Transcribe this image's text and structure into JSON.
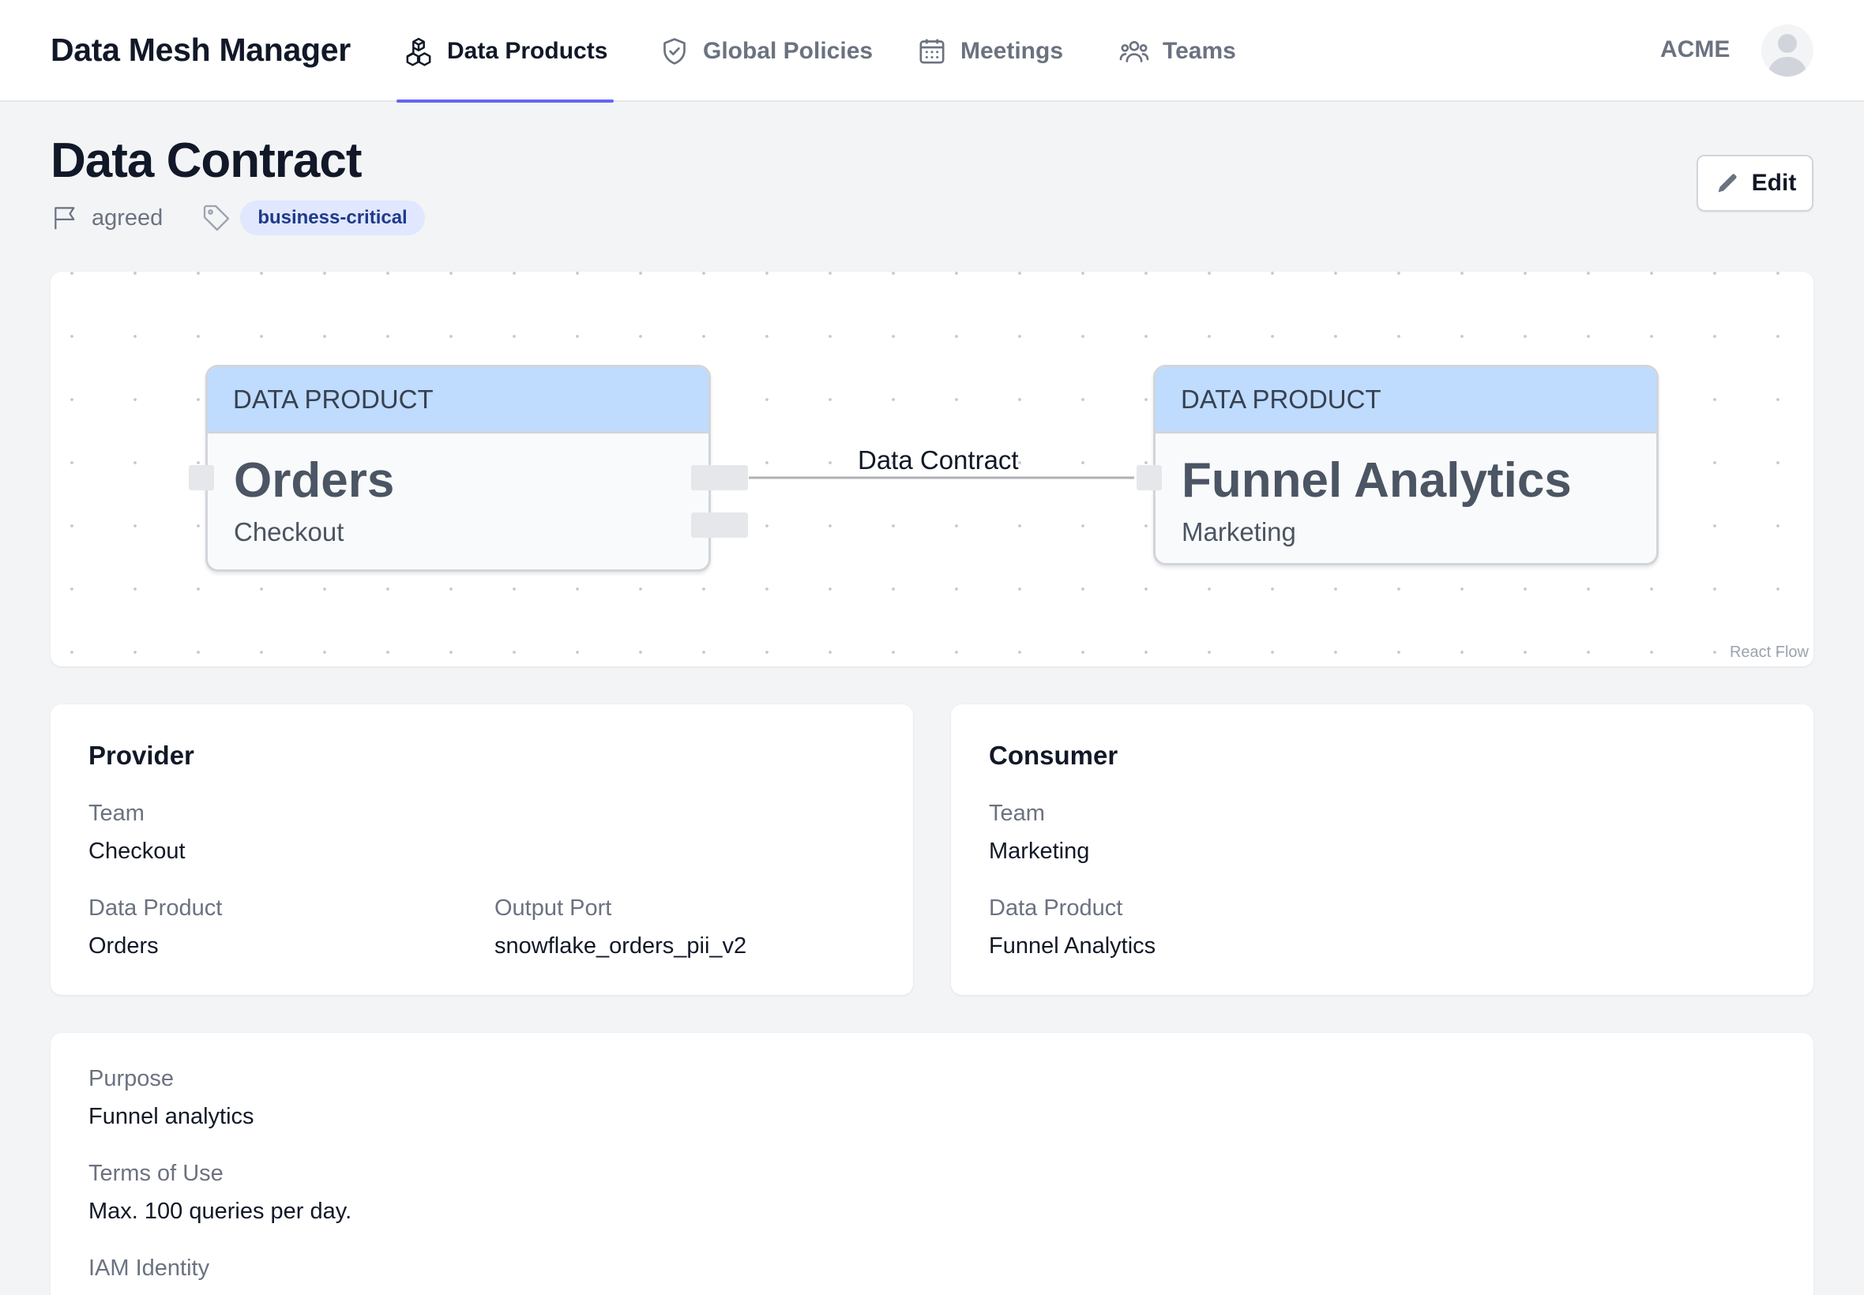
{
  "nav": {
    "brand": "Data Mesh Manager",
    "items": [
      {
        "label": "Data Products",
        "icon": "cubes-icon",
        "active": true
      },
      {
        "label": "Global Policies",
        "icon": "shield-icon",
        "active": false
      },
      {
        "label": "Meetings",
        "icon": "calendar-icon",
        "active": false
      },
      {
        "label": "Teams",
        "icon": "users-icon",
        "active": false
      }
    ],
    "org": "ACME",
    "accent_color": "#6366f1"
  },
  "header": {
    "title": "Data Contract",
    "status": "agreed",
    "tag": "business-critical",
    "edit_label": "Edit"
  },
  "flow": {
    "provider": {
      "kind": "DATA PRODUCT",
      "name": "Orders",
      "team": "Checkout"
    },
    "consumer": {
      "kind": "DATA PRODUCT",
      "name": "Funnel Analytics",
      "team": "Marketing"
    },
    "edge_label": "Data Contract",
    "attribution": "React Flow",
    "node_header_color": "#bfdbfe"
  },
  "provider": {
    "title": "Provider",
    "team_label": "Team",
    "team": "Checkout",
    "product_label": "Data Product",
    "product": "Orders",
    "port_label": "Output Port",
    "port": "snowflake_orders_pii_v2"
  },
  "consumer": {
    "title": "Consumer",
    "team_label": "Team",
    "team": "Marketing",
    "product_label": "Data Product",
    "product": "Funnel Analytics"
  },
  "details": {
    "purpose_label": "Purpose",
    "purpose": "Funnel analytics",
    "terms_label": "Terms of Use",
    "terms": "Max. 100 queries per day.",
    "iam_label": "IAM Identity"
  }
}
